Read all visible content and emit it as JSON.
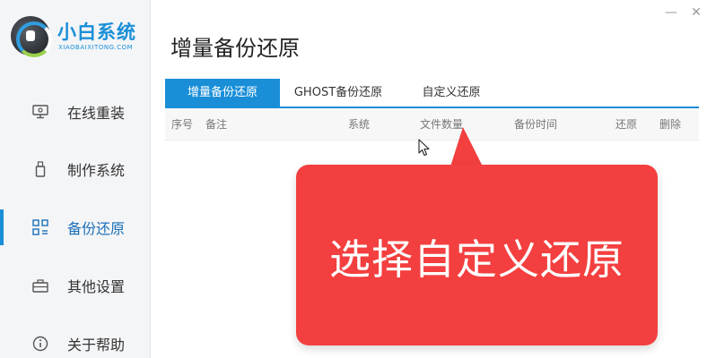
{
  "app": {
    "logo_title": "小白系统",
    "logo_subtitle": "XIAOBAIXITONG.COM"
  },
  "window": {
    "minimize": "—",
    "close": "✕"
  },
  "sidebar": {
    "items": [
      {
        "label": "在线重装",
        "icon": "monitor-icon"
      },
      {
        "label": "制作系统",
        "icon": "usb-icon"
      },
      {
        "label": "备份还原",
        "icon": "grid-icon",
        "active": true
      },
      {
        "label": "其他设置",
        "icon": "briefcase-icon"
      },
      {
        "label": "关于帮助",
        "icon": "info-icon"
      }
    ]
  },
  "main": {
    "page_title": "增量备份还原",
    "tabs": [
      {
        "label": "增量备份还原",
        "active": true
      },
      {
        "label": "GHOST备份还原"
      },
      {
        "label": "自定义还原"
      }
    ],
    "table_headers": [
      "序号",
      "备注",
      "系统",
      "文件数量",
      "备份时间",
      "还原",
      "删除"
    ]
  },
  "callout": {
    "text": "选择自定义还原"
  },
  "colors": {
    "accent": "#1a8fd8",
    "callout": "#f33f3f"
  }
}
